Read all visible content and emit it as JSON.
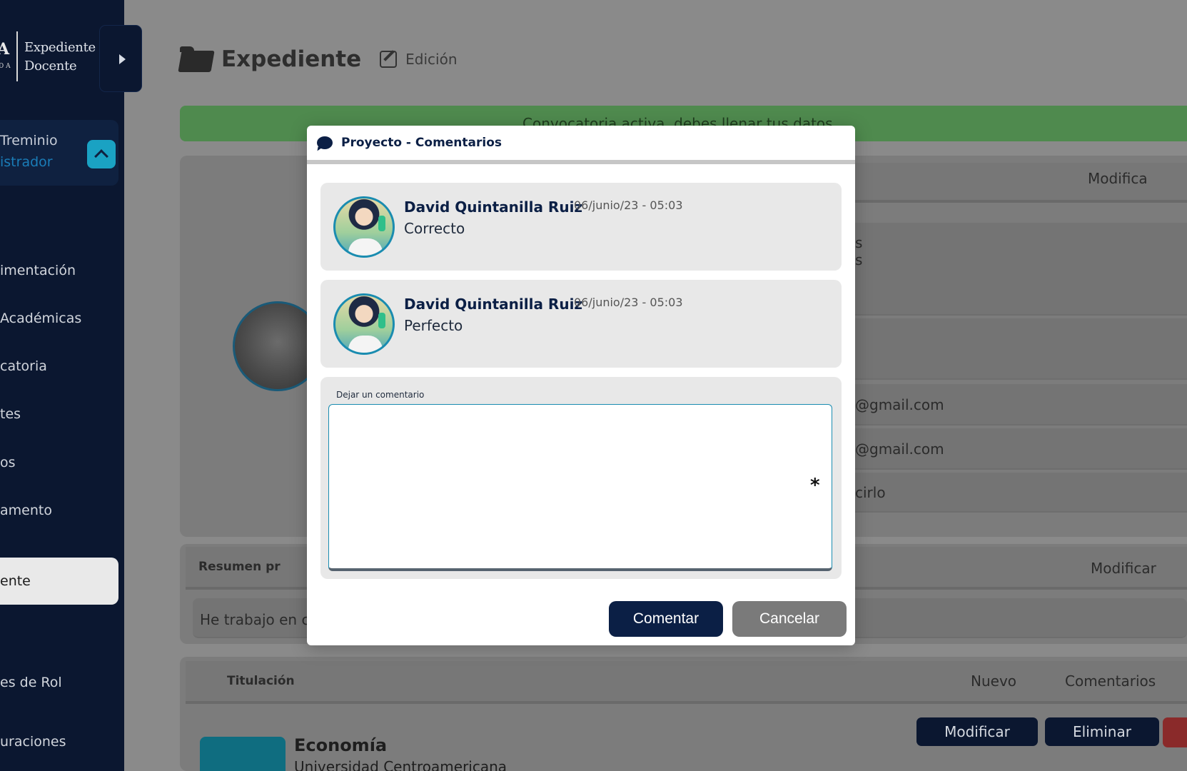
{
  "sidebar": {
    "logo_mark": "A",
    "logo_sub": "D\nA",
    "logo_name_line1": "Expediente",
    "logo_name_line2": "Docente",
    "user_name": "Treminio",
    "user_role": "istrador",
    "items": [
      {
        "label": "imentación"
      },
      {
        "label": "Académicas"
      },
      {
        "label": "catoria"
      },
      {
        "label": "tes"
      },
      {
        "label": "os"
      },
      {
        "label": "amento"
      },
      {
        "label": "ente"
      },
      {
        "label": "es de Rol"
      },
      {
        "label": "uraciones"
      }
    ]
  },
  "main": {
    "title": "Expediente",
    "edit_label": "Edición",
    "banner": "Convocatoria activa, debes llenar tus datos.",
    "modify_label": "Modifica",
    "partial_s1": "s",
    "partial_s2": "s",
    "email1": "@gmail.com",
    "email2": "@gmail.com",
    "field3": "cirlo",
    "summary_title": "Resumen pr",
    "summary_modify": "Modificar",
    "summary_text": "He trabajo en c",
    "titulacion_title": "Titulación",
    "nuevo_label": "Nuevo",
    "comentarios_label": "Comentarios",
    "modificar_btn": "Modificar",
    "eliminar_btn": "Eliminar",
    "degree": "Economía",
    "university": "Universidad Centroamericana"
  },
  "modal": {
    "title": "Proyecto - Comentarios",
    "comments": [
      {
        "author": "David Quintanilla Ruiz",
        "date": "06/junio/23 - 05:03",
        "text": "Correcto"
      },
      {
        "author": "David Quintanilla Ruiz",
        "date": "06/junio/23 - 05:03",
        "text": "Perfecto"
      }
    ],
    "form_label": "Dejar un comentario",
    "textarea_value": "",
    "required_mark": "*",
    "submit_label": "Comentar",
    "cancel_label": "Cancelar"
  },
  "colors": {
    "brand_navy": "#0b1f45",
    "accent_teal": "#1a8cb0",
    "overlay_gray": "#8a8a8a"
  }
}
